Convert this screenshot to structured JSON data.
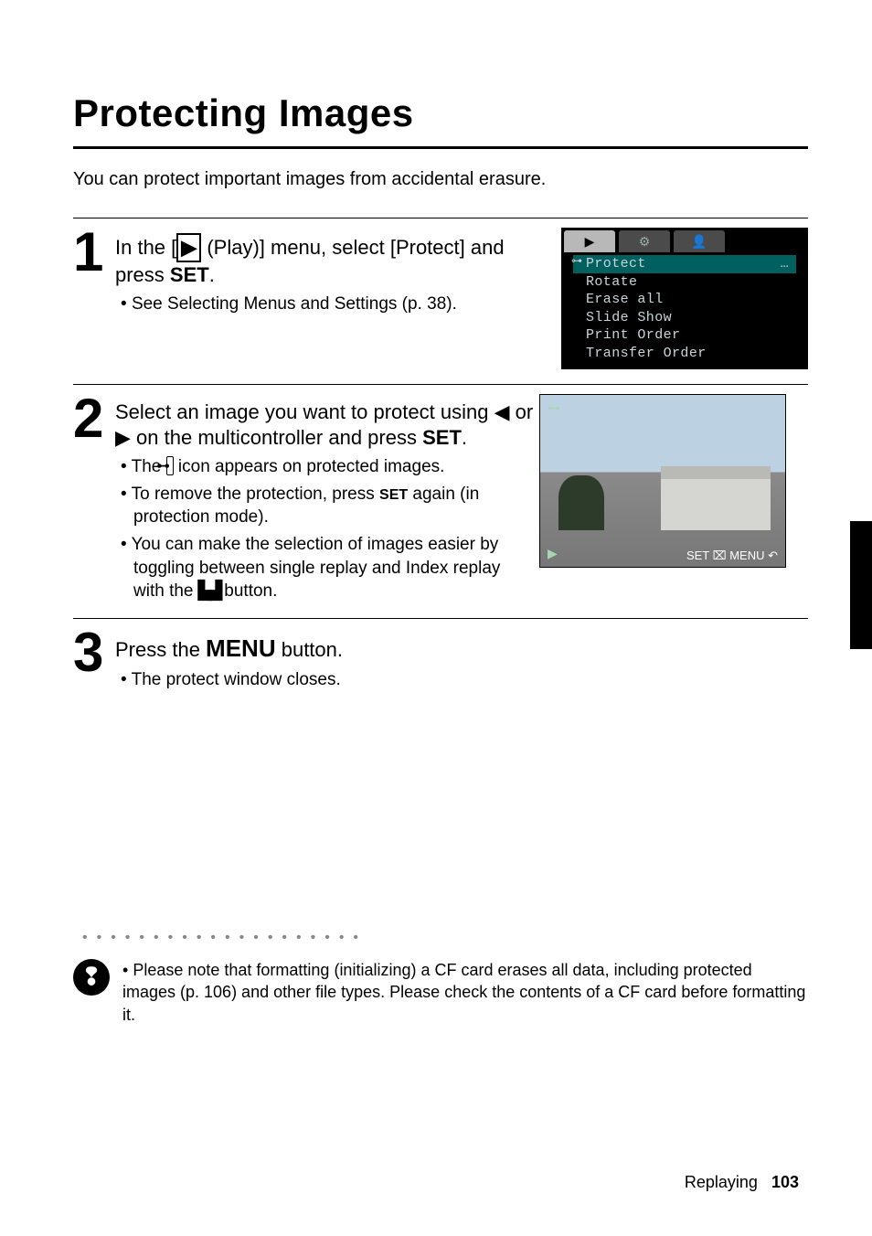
{
  "title": "Protecting Images",
  "intro": "You can protect important images from accidental erasure.",
  "steps": {
    "s1": {
      "num": "1",
      "head_prefix": "In the [",
      "head_mid": " (Play)] menu, select [Protect] and press ",
      "set": "SET",
      "period": ".",
      "bullets": [
        "See Selecting Menus and Settings (p. 38)."
      ]
    },
    "s2": {
      "num": "2",
      "head_a": "Select an image you want to protect using ",
      "head_b": " or ",
      "head_c": " on the multicontroller and press ",
      "set": "SET",
      "period": ".",
      "bullets": [
        "The ⌧ icon appears on protected images.",
        "To remove the protection, press SET again (in protection mode).",
        "You can make the selection of images easier by toggling between single replay and Index replay with the ⧉ button."
      ],
      "b1_a": "The ",
      "b1_b": " icon appears on protected images.",
      "b2_a": "To remove the protection, press ",
      "b2_b": " again (in protection mode).",
      "b3_a": "You can make the selection of images easier by toggling between single replay and Index replay with the ",
      "b3_b": " button."
    },
    "s3": {
      "num": "3",
      "head_a": "Press the ",
      "menu": "MENU",
      "head_b": " button.",
      "bullets": [
        "The protect window closes."
      ]
    }
  },
  "menu_shot": {
    "tabs": [
      "▶",
      "⚙",
      "👤"
    ],
    "items": [
      "Protect",
      "Rotate",
      "Erase all",
      "Slide Show",
      "Print Order",
      "Transfer Order"
    ]
  },
  "photo_hud": "SET ⌧ MENU ↶",
  "note_prefix": "• ",
  "note": "Please note that formatting (initializing) a CF card erases all data, including protected images (p. 106) and other file types. Please check the contents of a CF card before formatting it.",
  "footer_label": "Replaying",
  "footer_page": "103",
  "icon_labels": {
    "play": "▶",
    "protect": "⊶",
    "left": "◀",
    "right": "▶",
    "set_small": "SET",
    "thumb": "▙▟"
  }
}
